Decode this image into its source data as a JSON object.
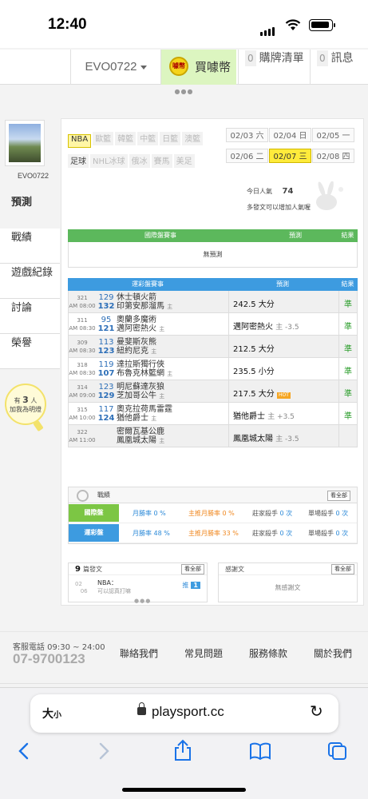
{
  "status": {
    "time": "12:40"
  },
  "topnav": {
    "user": "EVO0722",
    "buy_label": "買噱幣",
    "coin_text": "噱幣",
    "cart_count": "0",
    "cart_label": "購牌清單",
    "msg_count": "0",
    "msg_label": "訊息"
  },
  "sidebar": {
    "user": "EVO0722",
    "menu": [
      "預測",
      "戰績",
      "遊戲紀錄",
      "討論",
      "榮譽"
    ],
    "bulb": {
      "pre": "有",
      "count": "3",
      "suffix": "人",
      "line2": "加我為明燈"
    }
  },
  "leagues": [
    {
      "label": "NBA",
      "state": "on"
    },
    {
      "label": "歐籃",
      "state": "off"
    },
    {
      "label": "韓籃",
      "state": "off"
    },
    {
      "label": "中籃",
      "state": "off"
    },
    {
      "label": "日籃",
      "state": "off"
    },
    {
      "label": "澳籃",
      "state": "off"
    },
    {
      "label": "足球",
      "state": "plain"
    },
    {
      "label": "NHL冰球",
      "state": "off"
    },
    {
      "label": "俄冰",
      "state": "off"
    },
    {
      "label": "賽馬",
      "state": "off"
    },
    {
      "label": "美足",
      "state": "off"
    }
  ],
  "dates": [
    {
      "label": "02/03 六",
      "on": false
    },
    {
      "label": "02/04 日",
      "on": false
    },
    {
      "label": "02/05 一",
      "on": false
    },
    {
      "label": "02/06 二",
      "on": false
    },
    {
      "label": "02/07 三",
      "on": true
    },
    {
      "label": "02/08 四",
      "on": false
    }
  ],
  "popularity": {
    "label": "今日人氣",
    "value": "74",
    "sub": "多發文可以增加人氣喔"
  },
  "intl": {
    "h1": "國際盤賽事",
    "h2": "預測",
    "h3": "結果",
    "empty": "無預測"
  },
  "lottery": {
    "h1": "運彩盤賽事",
    "h2": "預測",
    "h3": "結果",
    "rows": [
      {
        "no": "321",
        "time": "AM 08:00",
        "n1": "129",
        "n2": "132",
        "t1": "休士頓火箭",
        "t2": "印第安那溜馬",
        "mark": "主",
        "pred": "242.5 大分",
        "m": "",
        "hot": "",
        "res": "準"
      },
      {
        "no": "311",
        "time": "AM 08:30",
        "n1": "95",
        "n2": "121",
        "t1": "奧蘭多魔術",
        "t2": "邁阿密熱火",
        "mark": "主",
        "pred": "邁阿密熱火",
        "m": "主 -3.5",
        "hot": "",
        "res": "準"
      },
      {
        "no": "309",
        "time": "AM 08:30",
        "n1": "113",
        "n2": "123",
        "t1": "曼斐斯灰熊",
        "t2": "紐約尼克",
        "mark": "主",
        "pred": "212.5 大分",
        "m": "",
        "hot": "",
        "res": "準"
      },
      {
        "no": "318",
        "time": "AM 08:30",
        "n1": "119",
        "n2": "107",
        "t1": "達拉斯獨行俠",
        "t2": "布魯克林籃網",
        "mark": "主",
        "pred": "235.5 小分",
        "m": "",
        "hot": "",
        "res": "準"
      },
      {
        "no": "314",
        "time": "AM 09:00",
        "n1": "123",
        "n2": "129",
        "t1": "明尼蘇達灰狼",
        "t2": "芝加哥公牛",
        "mark": "主",
        "pred": "217.5 大分",
        "m": "",
        "hot": "HOT",
        "res": "準"
      },
      {
        "no": "315",
        "time": "AM 10:00",
        "n1": "117",
        "n2": "124",
        "t1": "奧克拉荷馬雷霆",
        "t2": "猶他爵士",
        "mark": "主",
        "pred": "猶他爵士",
        "m": "主 +3.5",
        "hot": "",
        "res": "準"
      },
      {
        "no": "322",
        "time": "AM 11:00",
        "n1": "",
        "n2": "",
        "t1": "密爾瓦基公鹿",
        "t2": "鳳凰城太陽",
        "mark": "主",
        "pred": "鳳凰城太陽",
        "m": "主 -3.5",
        "hot": "",
        "res": ""
      }
    ]
  },
  "stats": {
    "title": "戰績",
    "all": "看全部",
    "rows": [
      {
        "label": "國際盤",
        "color": "#7cc644",
        "month_label": "月勝率",
        "month": "0 %",
        "main_label": "主推月勝率",
        "main": "0 %",
        "home_label": "莊家殺手",
        "home": "0 次",
        "single_label": "單場殺手",
        "single": "0 次"
      },
      {
        "label": "運彩盤",
        "color": "#3d9be0",
        "month_label": "月勝率",
        "month": "48 %",
        "main_label": "主推月勝率",
        "main": "33 %",
        "home_label": "莊家殺手",
        "home": "0 次",
        "single_label": "單場殺手",
        "single": "0 次"
      }
    ]
  },
  "articles": {
    "count": "9",
    "label": "篇發文",
    "all": "看全部",
    "item": {
      "month": "02",
      "day": "06",
      "title": "NBA：",
      "sub": "可以認真打嘛",
      "push_label": "推",
      "push": "1"
    }
  },
  "thanks": {
    "label": "感謝文",
    "all": "看全部",
    "none": "無感謝文"
  },
  "footer": {
    "service": "客服電話 09:30 ~ 24:00",
    "phone": "07-9700123",
    "links": [
      "聯絡我們",
      "常見問題",
      "服務條款",
      "關於我們"
    ]
  },
  "browser": {
    "aa": "大",
    "aa_small": "小",
    "url": "playsport.cc"
  },
  "colors": {
    "accent_green": "#5cb85c",
    "accent_blue": "#3d9be0",
    "selected_yellow": "#ffeb3b"
  }
}
